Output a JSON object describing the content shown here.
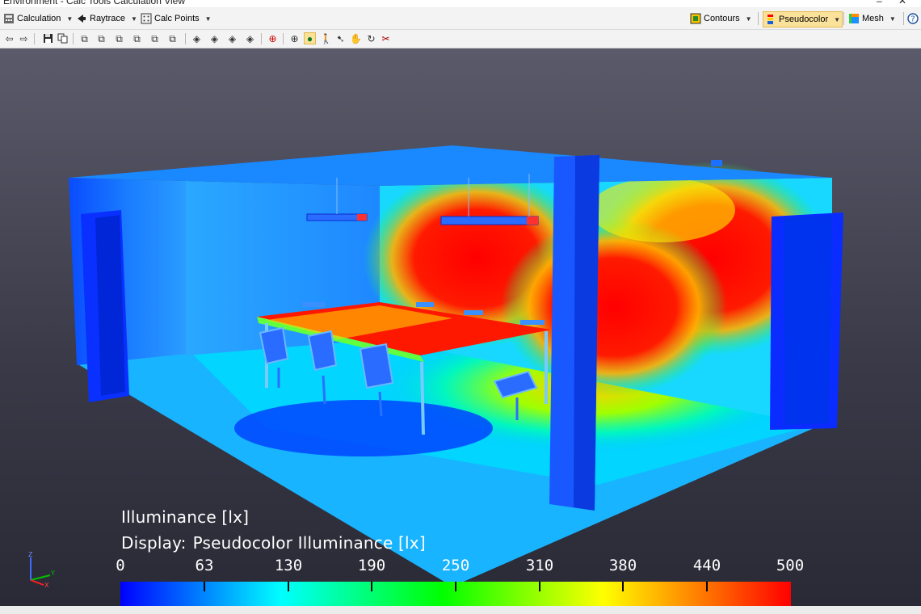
{
  "window": {
    "title": "Environment - Calc Tools Calculation View"
  },
  "menubar": {
    "calculation": {
      "label": "Calculation",
      "icon": "calculator-icon"
    },
    "raytrace": {
      "label": "Raytrace",
      "icon": "raytrace-icon"
    },
    "calc_points": {
      "label": "Calc Points",
      "icon": "grid-points-icon"
    },
    "contours": {
      "label": "Contours",
      "icon": "contours-icon"
    },
    "pseudocolor": {
      "label": "Pseudocolor",
      "icon": "pseudocolor-icon",
      "active": true
    },
    "mesh": {
      "label": "Mesh",
      "icon": "mesh-icon"
    },
    "help_icon": "help-icon"
  },
  "toolbar": {
    "icons": [
      "back-arrow-icon",
      "forward-arrow-icon",
      "save-icon",
      "copy-icon",
      "view-front-icon",
      "view-back-icon",
      "view-left-icon",
      "view-right-icon",
      "view-iso-icon",
      "orbit-1-icon",
      "orbit-2-icon",
      "orbit-3-icon",
      "orbit-4-icon",
      "zoom-window-icon",
      "zoom-icon",
      "orbit-active-icon",
      "walk-icon",
      "fly-icon",
      "pan-icon",
      "rotate-icon",
      "clip-icon"
    ],
    "active_tool": "orbit-active-icon"
  },
  "viewport": {
    "legend": {
      "title": "Illuminance [lx]",
      "display_label": "Display:",
      "display_value": "Pseudocolor Illuminance [lx]",
      "ticks": [
        "0",
        "63",
        "130",
        "190",
        "250",
        "310",
        "380",
        "440",
        "500"
      ],
      "colors": [
        "#0000ff",
        "#0080ff",
        "#00ffff",
        "#00ff00",
        "#ffff00",
        "#ff8000",
        "#ff0000"
      ]
    },
    "axes": {
      "z": "Z",
      "y": "Y",
      "x": "X"
    }
  }
}
